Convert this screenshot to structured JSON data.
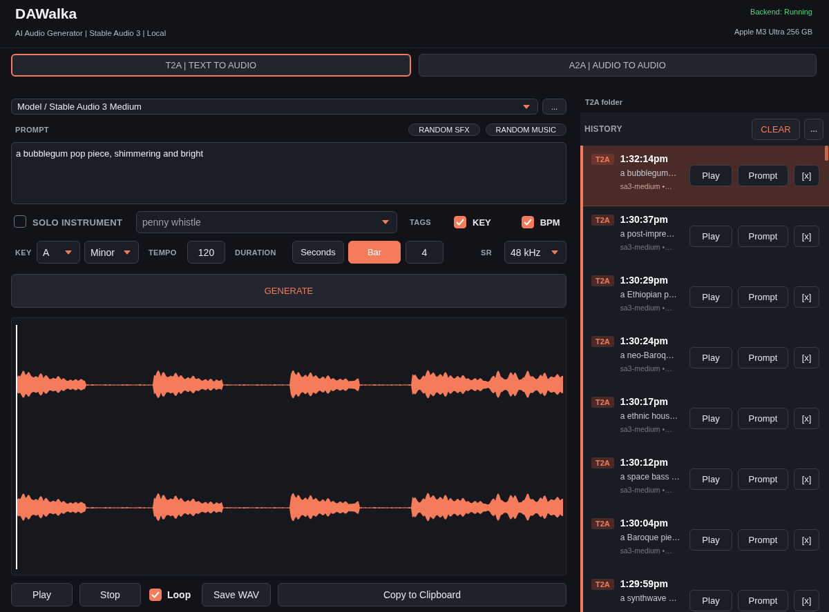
{
  "header": {
    "title": "DAWalka",
    "subtitle": "AI Audio Generator | Stable Audio 3 | Local",
    "status": "Backend: Running",
    "device": "Apple M3 Ultra 256 GB"
  },
  "tabs": [
    {
      "label": "T2A  |  TEXT TO AUDIO",
      "selected": true
    },
    {
      "label": "A2A  |  AUDIO TO AUDIO",
      "selected": false
    }
  ],
  "model": {
    "value": "Model / Stable Audio 3 Medium",
    "more": "..."
  },
  "prompt": {
    "label": "PROMPT",
    "buttons": [
      "RANDOM SFX",
      "RANDOM MUSIC"
    ],
    "value": "a bubblegum pop piece, shimmering and bright"
  },
  "solo": {
    "label": "SOLO INSTRUMENT",
    "checked": false,
    "instrument": "penny whistle"
  },
  "tags": {
    "label": "TAGS",
    "items": [
      {
        "label": "KEY",
        "checked": true
      },
      {
        "label": "BPM",
        "checked": true
      }
    ]
  },
  "settings": {
    "key_label": "KEY",
    "key": "A",
    "mode": "Minor",
    "tempo_label": "TEMPO",
    "tempo": "120",
    "duration_label": "DURATION",
    "duration_units": [
      {
        "label": "Seconds",
        "selected": false
      },
      {
        "label": "Bar",
        "selected": true
      }
    ],
    "duration": "4",
    "sr_label": "SR",
    "sr": "48 kHz"
  },
  "generate": "GENERATE",
  "player": {
    "buttons": [
      "Play",
      "Stop"
    ],
    "loop": {
      "label": "Loop",
      "checked": true
    },
    "save": "Save WAV",
    "copy": "Copy to Clipboard"
  },
  "folder": "T2A folder",
  "history": {
    "title": "HISTORY",
    "clear": "CLEAR",
    "more": "...",
    "items": [
      {
        "tag": "T2A",
        "time": "1:32:14pm",
        "prompt": "a bubblegum…",
        "meta": "sa3-medium  •…",
        "selected": true,
        "actions": [
          "Play",
          "Prompt",
          "[x]"
        ]
      },
      {
        "tag": "T2A",
        "time": "1:30:37pm",
        "prompt": "a post-impre…",
        "meta": "sa3-medium  •…",
        "selected": false,
        "actions": [
          "Play",
          "Prompt",
          "[x]"
        ]
      },
      {
        "tag": "T2A",
        "time": "1:30:29pm",
        "prompt": "a Ethiopian p…",
        "meta": "sa3-medium  •…",
        "selected": false,
        "actions": [
          "Play",
          "Prompt",
          "[x]"
        ]
      },
      {
        "tag": "T2A",
        "time": "1:30:24pm",
        "prompt": "a neo-Baroq…",
        "meta": "sa3-medium  •…",
        "selected": false,
        "actions": [
          "Play",
          "Prompt",
          "[x]"
        ]
      },
      {
        "tag": "T2A",
        "time": "1:30:17pm",
        "prompt": "a ethnic hous…",
        "meta": "sa3-medium  •…",
        "selected": false,
        "actions": [
          "Play",
          "Prompt",
          "[x]"
        ]
      },
      {
        "tag": "T2A",
        "time": "1:30:12pm",
        "prompt": "a space bass …",
        "meta": "sa3-medium  •…",
        "selected": false,
        "actions": [
          "Play",
          "Prompt",
          "[x]"
        ]
      },
      {
        "tag": "T2A",
        "time": "1:30:04pm",
        "prompt": "a Baroque pie…",
        "meta": "sa3-medium  •…",
        "selected": false,
        "actions": [
          "Play",
          "Prompt",
          "[x]"
        ]
      },
      {
        "tag": "T2A",
        "time": "1:29:59pm",
        "prompt": "a synthwave …",
        "selected": false,
        "actions": [
          "Play",
          "Prompt",
          "[x]"
        ]
      }
    ]
  }
}
